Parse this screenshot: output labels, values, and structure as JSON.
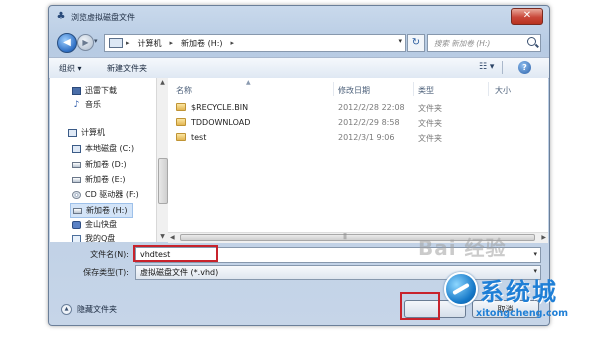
{
  "window": {
    "title": "浏览虚拟磁盘文件",
    "close_label": "✕"
  },
  "address": {
    "crumbs": [
      "计算机",
      "新加卷 (H:)"
    ],
    "search_placeholder": "搜索 新加卷 (H:)"
  },
  "toolbar": {
    "organize": "组织 ▾",
    "new_folder": "新建文件夹",
    "help": "?"
  },
  "sidebar": {
    "items": [
      {
        "label": "迅雷下载",
        "icon": "download-folder-icon"
      },
      {
        "label": "音乐",
        "icon": "music-icon"
      },
      {
        "label": "计算机",
        "icon": "computer-icon"
      },
      {
        "label": "本地磁盘 (C:)",
        "icon": "disk-icon"
      },
      {
        "label": "新加卷 (D:)",
        "icon": "disk-icon"
      },
      {
        "label": "新加卷 (E:)",
        "icon": "disk-icon"
      },
      {
        "label": "CD 驱动器 (F:)",
        "icon": "cd-icon"
      },
      {
        "label": "新加卷 (H:)",
        "icon": "disk-icon"
      },
      {
        "label": "金山快盘",
        "icon": "cloud-drive-icon"
      },
      {
        "label": "我的Q盘",
        "icon": "qq-drive-icon"
      }
    ],
    "selected": "新加卷 (H:)"
  },
  "list": {
    "columns": [
      "名称",
      "修改日期",
      "类型",
      "大小"
    ],
    "rows": [
      {
        "name": "$RECYCLE.BIN",
        "date": "2012/2/28 22:08",
        "type": "文件夹"
      },
      {
        "name": "TDDOWNLOAD",
        "date": "2012/2/29 8:58",
        "type": "文件夹"
      },
      {
        "name": "test",
        "date": "2012/3/1 9:06",
        "type": "文件夹"
      }
    ]
  },
  "form": {
    "filename_label": "文件名(N):",
    "filename_value": "vhdtest",
    "filetype_label": "保存类型(T):",
    "filetype_value": "虚拟磁盘文件 (*.vhd)",
    "hide_folders": "隐藏文件夹",
    "cancel": "取消"
  },
  "watermark": {
    "chars": "Bai 经验",
    "brand": "系统城",
    "url": "xitongcheng.com"
  },
  "colors": {
    "highlight_border": "#c8232c",
    "brand_blue": "#1f7fd6"
  }
}
